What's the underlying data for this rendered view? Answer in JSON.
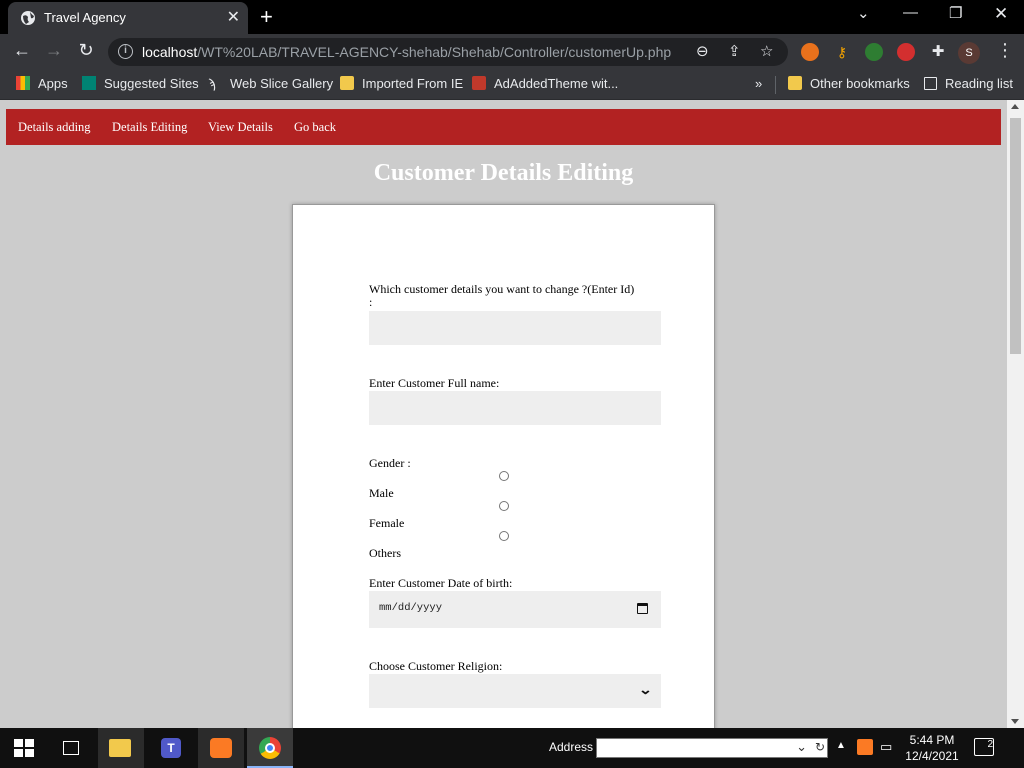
{
  "browser": {
    "tab_title": "Travel Agency",
    "url_host": "localhost",
    "url_path": "/WT%20LAB/TRAVEL-AGENCY-shehab/Shehab/Controller/customerUp.php",
    "profile_initial": "S",
    "bookmarks": [
      {
        "label": "Apps"
      },
      {
        "label": "Suggested Sites"
      },
      {
        "label": "Web Slice Gallery"
      },
      {
        "label": "Imported From IE"
      },
      {
        "label": "AdAddedTheme wit..."
      }
    ],
    "bookmarks_overflow": "»",
    "other_bookmarks": "Other bookmarks",
    "reading_list": "Reading list"
  },
  "page": {
    "nav": [
      {
        "label": "Details adding"
      },
      {
        "label": "Details Editing"
      },
      {
        "label": "View Details"
      },
      {
        "label": "Go back"
      }
    ],
    "heading": "Customer Details Editing",
    "form": {
      "id_label_line1": "Which customer details you want to change ?(Enter Id)",
      "id_label_line2": ":",
      "name_label": "Enter Customer Full name:",
      "gender_label": "Gender :",
      "gender_options": [
        {
          "label": "Male"
        },
        {
          "label": "Female"
        },
        {
          "label": "Others"
        }
      ],
      "dob_label": "Enter Customer Date of birth:",
      "dob_placeholder": "mm/dd/yyyy",
      "religion_label": "Choose Customer Religion:"
    }
  },
  "taskbar": {
    "address_label": "Address",
    "time": "5:44 PM",
    "date": "12/4/2021",
    "notification_count": "2"
  },
  "colors": {
    "nav_bg": "#b22222",
    "page_bg": "#cccccc",
    "field_bg": "#eeeeee"
  }
}
